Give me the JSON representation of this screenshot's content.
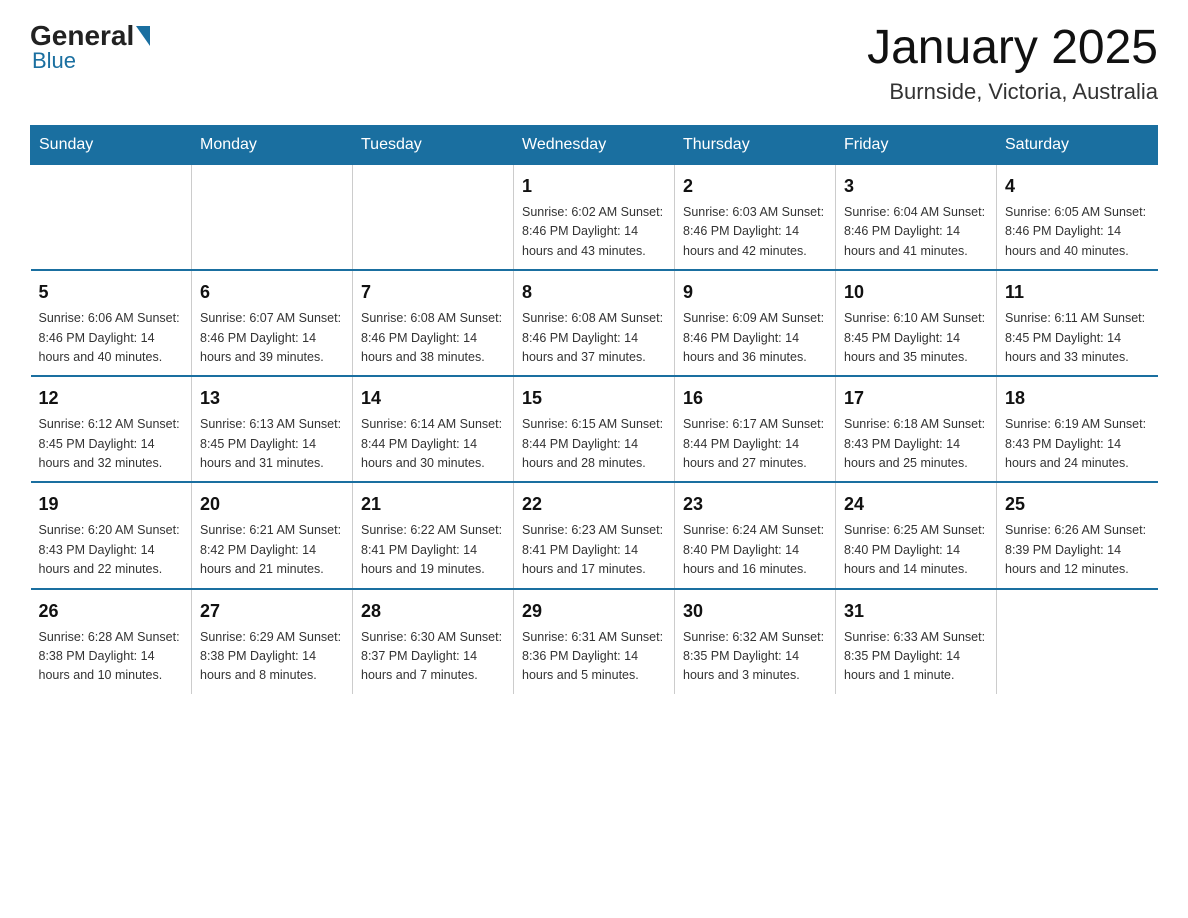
{
  "header": {
    "logo": {
      "general": "General",
      "blue": "Blue"
    },
    "title": "January 2025",
    "location": "Burnside, Victoria, Australia"
  },
  "calendar": {
    "days_of_week": [
      "Sunday",
      "Monday",
      "Tuesday",
      "Wednesday",
      "Thursday",
      "Friday",
      "Saturday"
    ],
    "weeks": [
      [
        {
          "day": "",
          "info": ""
        },
        {
          "day": "",
          "info": ""
        },
        {
          "day": "",
          "info": ""
        },
        {
          "day": "1",
          "info": "Sunrise: 6:02 AM\nSunset: 8:46 PM\nDaylight: 14 hours and 43 minutes."
        },
        {
          "day": "2",
          "info": "Sunrise: 6:03 AM\nSunset: 8:46 PM\nDaylight: 14 hours and 42 minutes."
        },
        {
          "day": "3",
          "info": "Sunrise: 6:04 AM\nSunset: 8:46 PM\nDaylight: 14 hours and 41 minutes."
        },
        {
          "day": "4",
          "info": "Sunrise: 6:05 AM\nSunset: 8:46 PM\nDaylight: 14 hours and 40 minutes."
        }
      ],
      [
        {
          "day": "5",
          "info": "Sunrise: 6:06 AM\nSunset: 8:46 PM\nDaylight: 14 hours and 40 minutes."
        },
        {
          "day": "6",
          "info": "Sunrise: 6:07 AM\nSunset: 8:46 PM\nDaylight: 14 hours and 39 minutes."
        },
        {
          "day": "7",
          "info": "Sunrise: 6:08 AM\nSunset: 8:46 PM\nDaylight: 14 hours and 38 minutes."
        },
        {
          "day": "8",
          "info": "Sunrise: 6:08 AM\nSunset: 8:46 PM\nDaylight: 14 hours and 37 minutes."
        },
        {
          "day": "9",
          "info": "Sunrise: 6:09 AM\nSunset: 8:46 PM\nDaylight: 14 hours and 36 minutes."
        },
        {
          "day": "10",
          "info": "Sunrise: 6:10 AM\nSunset: 8:45 PM\nDaylight: 14 hours and 35 minutes."
        },
        {
          "day": "11",
          "info": "Sunrise: 6:11 AM\nSunset: 8:45 PM\nDaylight: 14 hours and 33 minutes."
        }
      ],
      [
        {
          "day": "12",
          "info": "Sunrise: 6:12 AM\nSunset: 8:45 PM\nDaylight: 14 hours and 32 minutes."
        },
        {
          "day": "13",
          "info": "Sunrise: 6:13 AM\nSunset: 8:45 PM\nDaylight: 14 hours and 31 minutes."
        },
        {
          "day": "14",
          "info": "Sunrise: 6:14 AM\nSunset: 8:44 PM\nDaylight: 14 hours and 30 minutes."
        },
        {
          "day": "15",
          "info": "Sunrise: 6:15 AM\nSunset: 8:44 PM\nDaylight: 14 hours and 28 minutes."
        },
        {
          "day": "16",
          "info": "Sunrise: 6:17 AM\nSunset: 8:44 PM\nDaylight: 14 hours and 27 minutes."
        },
        {
          "day": "17",
          "info": "Sunrise: 6:18 AM\nSunset: 8:43 PM\nDaylight: 14 hours and 25 minutes."
        },
        {
          "day": "18",
          "info": "Sunrise: 6:19 AM\nSunset: 8:43 PM\nDaylight: 14 hours and 24 minutes."
        }
      ],
      [
        {
          "day": "19",
          "info": "Sunrise: 6:20 AM\nSunset: 8:43 PM\nDaylight: 14 hours and 22 minutes."
        },
        {
          "day": "20",
          "info": "Sunrise: 6:21 AM\nSunset: 8:42 PM\nDaylight: 14 hours and 21 minutes."
        },
        {
          "day": "21",
          "info": "Sunrise: 6:22 AM\nSunset: 8:41 PM\nDaylight: 14 hours and 19 minutes."
        },
        {
          "day": "22",
          "info": "Sunrise: 6:23 AM\nSunset: 8:41 PM\nDaylight: 14 hours and 17 minutes."
        },
        {
          "day": "23",
          "info": "Sunrise: 6:24 AM\nSunset: 8:40 PM\nDaylight: 14 hours and 16 minutes."
        },
        {
          "day": "24",
          "info": "Sunrise: 6:25 AM\nSunset: 8:40 PM\nDaylight: 14 hours and 14 minutes."
        },
        {
          "day": "25",
          "info": "Sunrise: 6:26 AM\nSunset: 8:39 PM\nDaylight: 14 hours and 12 minutes."
        }
      ],
      [
        {
          "day": "26",
          "info": "Sunrise: 6:28 AM\nSunset: 8:38 PM\nDaylight: 14 hours and 10 minutes."
        },
        {
          "day": "27",
          "info": "Sunrise: 6:29 AM\nSunset: 8:38 PM\nDaylight: 14 hours and 8 minutes."
        },
        {
          "day": "28",
          "info": "Sunrise: 6:30 AM\nSunset: 8:37 PM\nDaylight: 14 hours and 7 minutes."
        },
        {
          "day": "29",
          "info": "Sunrise: 6:31 AM\nSunset: 8:36 PM\nDaylight: 14 hours and 5 minutes."
        },
        {
          "day": "30",
          "info": "Sunrise: 6:32 AM\nSunset: 8:35 PM\nDaylight: 14 hours and 3 minutes."
        },
        {
          "day": "31",
          "info": "Sunrise: 6:33 AM\nSunset: 8:35 PM\nDaylight: 14 hours and 1 minute."
        },
        {
          "day": "",
          "info": ""
        }
      ]
    ]
  }
}
